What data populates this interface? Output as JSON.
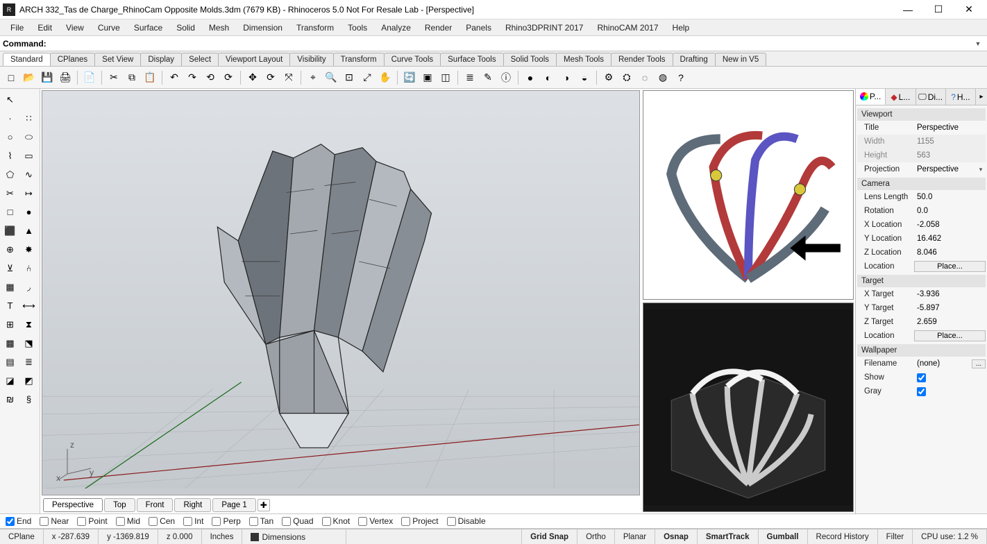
{
  "window": {
    "title": "ARCH 332_Tas de Charge_RhinoCam Opposite Molds.3dm (7679 KB) - Rhinoceros 5.0 Not For Resale Lab - [Perspective]",
    "minimize_glyph": "—",
    "maximize_glyph": "☐",
    "close_glyph": "✕"
  },
  "menu": {
    "items": [
      "File",
      "Edit",
      "View",
      "Curve",
      "Surface",
      "Solid",
      "Mesh",
      "Dimension",
      "Transform",
      "Tools",
      "Analyze",
      "Render",
      "Panels",
      "Rhino3DPRINT 2017",
      "RhinoCAM 2017",
      "Help"
    ]
  },
  "command": {
    "label": "Command:",
    "value": ""
  },
  "toolbar_tabs": {
    "items": [
      "Standard",
      "CPlanes",
      "Set View",
      "Display",
      "Select",
      "Viewport Layout",
      "Visibility",
      "Transform",
      "Curve Tools",
      "Surface Tools",
      "Solid Tools",
      "Mesh Tools",
      "Render Tools",
      "Drafting",
      "New in V5"
    ],
    "active_index": 0
  },
  "main_toolbar": {
    "groups": [
      [
        "new-icon",
        "open-icon",
        "save-icon",
        "print-icon"
      ],
      [
        "import-icon"
      ],
      [
        "cut-icon",
        "copy-icon",
        "paste-icon"
      ],
      [
        "undo-icon",
        "redo-icon",
        "undo-multi-icon",
        "redo-multi-icon"
      ],
      [
        "move-icon",
        "rotate-icon",
        "scale-icon"
      ],
      [
        "zoom-extents-icon",
        "zoom-window-icon",
        "zoom-selected-icon",
        "zoom-dynamic-icon",
        "pan-icon"
      ],
      [
        "rotate-view-icon",
        "right-view-icon",
        "perspective-icon"
      ],
      [
        "layers-icon",
        "layer-edit-icon",
        "object-props-icon"
      ],
      [
        "render-icon",
        "render-preview-icon",
        "shade-icon",
        "ghosted-icon"
      ],
      [
        "options-icon",
        "settings-icon",
        "hide-icon",
        "show-icon",
        "help-icon"
      ]
    ],
    "glyphs": {
      "new-icon": "□",
      "open-icon": "📂",
      "save-icon": "💾",
      "print-icon": "🖨",
      "import-icon": "📄",
      "cut-icon": "✂",
      "copy-icon": "⧉",
      "paste-icon": "📋",
      "undo-icon": "↶",
      "redo-icon": "↷",
      "undo-multi-icon": "⟲",
      "redo-multi-icon": "⟳",
      "move-icon": "✥",
      "rotate-icon": "⟳",
      "scale-icon": "⤧",
      "zoom-extents-icon": "⌖",
      "zoom-window-icon": "🔍",
      "zoom-selected-icon": "⊡",
      "zoom-dynamic-icon": "⤢",
      "pan-icon": "✋",
      "rotate-view-icon": "🔄",
      "right-view-icon": "▣",
      "perspective-icon": "◫",
      "layers-icon": "≣",
      "layer-edit-icon": "✎",
      "object-props-icon": "ⓘ",
      "render-icon": "●",
      "render-preview-icon": "◐",
      "shade-icon": "◑",
      "ghosted-icon": "◒",
      "options-icon": "⚙",
      "settings-icon": "⛭",
      "hide-icon": "◌",
      "show-icon": "◍",
      "help-icon": "?"
    }
  },
  "left_tools": {
    "rows": [
      [
        "pointer-icon",
        ""
      ],
      [
        "point-icon",
        "points-icon"
      ],
      [
        "circle-icon",
        "ellipse-icon"
      ],
      [
        "polyline-icon",
        "rectangle-icon"
      ],
      [
        "polygon-icon",
        "curve-icon"
      ],
      [
        "trim-icon",
        "extend-icon"
      ],
      [
        "box-icon",
        "sphere-icon"
      ],
      [
        "cylinder-icon",
        "cone-icon"
      ],
      [
        "boolean-icon",
        "explode-icon"
      ],
      [
        "join-icon",
        "split-icon"
      ],
      [
        "group-icon",
        "fillet-icon"
      ],
      [
        "text-icon",
        "dim-icon"
      ],
      [
        "array-icon",
        "mirror-icon"
      ],
      [
        "mesh-icon",
        "analyze-icon"
      ],
      [
        "grid-icon",
        "layer-icon"
      ],
      [
        "solid-icon",
        "surface-icon"
      ],
      [
        "spiral-icon",
        "helix-icon"
      ]
    ],
    "glyphs": {
      "pointer-icon": "↖",
      "point-icon": "·",
      "points-icon": "∷",
      "circle-icon": "○",
      "ellipse-icon": "⬭",
      "polyline-icon": "⌇",
      "rectangle-icon": "▭",
      "polygon-icon": "⬠",
      "curve-icon": "∿",
      "trim-icon": "✂",
      "extend-icon": "↦",
      "box-icon": "□",
      "sphere-icon": "●",
      "cylinder-icon": "⬛",
      "cone-icon": "▲",
      "boolean-icon": "⊕",
      "explode-icon": "✸",
      "join-icon": "⊻",
      "split-icon": "⑃",
      "group-icon": "▦",
      "fillet-icon": "◞",
      "text-icon": "T",
      "dim-icon": "⟷",
      "array-icon": "⊞",
      "mirror-icon": "⧗",
      "mesh-icon": "▩",
      "analyze-icon": "⬔",
      "grid-icon": "▤",
      "layer-icon": "≣",
      "solid-icon": "◪",
      "surface-icon": "◩",
      "spiral-icon": "₪",
      "helix-icon": "§"
    }
  },
  "viewport": {
    "label": "Perspective",
    "axes": {
      "x": "x",
      "y": "y",
      "z": "z"
    }
  },
  "viewport_tabs": {
    "items": [
      "Perspective",
      "Top",
      "Front",
      "Right",
      "Page 1"
    ],
    "active_index": 0,
    "add_glyph": "✚"
  },
  "props_panel": {
    "tabs": [
      {
        "icon": "props-icon",
        "label": "P..."
      },
      {
        "icon": "layers-icon",
        "label": "L..."
      },
      {
        "icon": "display-icon",
        "label": "Di..."
      },
      {
        "icon": "help-icon",
        "label": "H..."
      }
    ],
    "active_tab": 0,
    "sections": {
      "viewport_h": "Viewport",
      "title_l": "Title",
      "title_v": "Perspective",
      "width_l": "Width",
      "width_v": "1155",
      "height_l": "Height",
      "height_v": "563",
      "proj_l": "Projection",
      "proj_v": "Perspective",
      "camera_h": "Camera",
      "lens_l": "Lens Length",
      "lens_v": "50.0",
      "rot_l": "Rotation",
      "rot_v": "0.0",
      "xl_l": "X Location",
      "xl_v": "-2.058",
      "yl_l": "Y Location",
      "yl_v": "16.462",
      "zl_l": "Z Location",
      "zl_v": "8.046",
      "loc_l": "Location",
      "place_btn": "Place...",
      "target_h": "Target",
      "xt_l": "X Target",
      "xt_v": "-3.936",
      "yt_l": "Y Target",
      "yt_v": "-5.897",
      "zt_l": "Z Target",
      "zt_v": "2.659",
      "locT_l": "Location",
      "wall_h": "Wallpaper",
      "fn_l": "Filename",
      "fn_v": "(none)",
      "dots": "...",
      "show_l": "Show",
      "gray_l": "Gray"
    }
  },
  "osnaps": {
    "items": [
      {
        "label": "End",
        "checked": true
      },
      {
        "label": "Near",
        "checked": false
      },
      {
        "label": "Point",
        "checked": false
      },
      {
        "label": "Mid",
        "checked": false
      },
      {
        "label": "Cen",
        "checked": false
      },
      {
        "label": "Int",
        "checked": false
      },
      {
        "label": "Perp",
        "checked": false
      },
      {
        "label": "Tan",
        "checked": false
      },
      {
        "label": "Quad",
        "checked": false
      },
      {
        "label": "Knot",
        "checked": false
      },
      {
        "label": "Vertex",
        "checked": false
      },
      {
        "label": "Project",
        "checked": false
      },
      {
        "label": "Disable",
        "checked": false
      }
    ]
  },
  "status": {
    "cplane": "CPlane",
    "x": "x -287.639",
    "y": "y -1369.819",
    "z": "z 0.000",
    "units": "Inches",
    "layer": "Dimensions",
    "toggles": [
      "Grid Snap",
      "Ortho",
      "Planar",
      "Osnap",
      "SmartTrack",
      "Gumball",
      "Record History",
      "Filter"
    ],
    "bold_toggles": [
      "Grid Snap",
      "Osnap",
      "SmartTrack",
      "Gumball"
    ],
    "cpu": "CPU use: 1.2 %"
  }
}
